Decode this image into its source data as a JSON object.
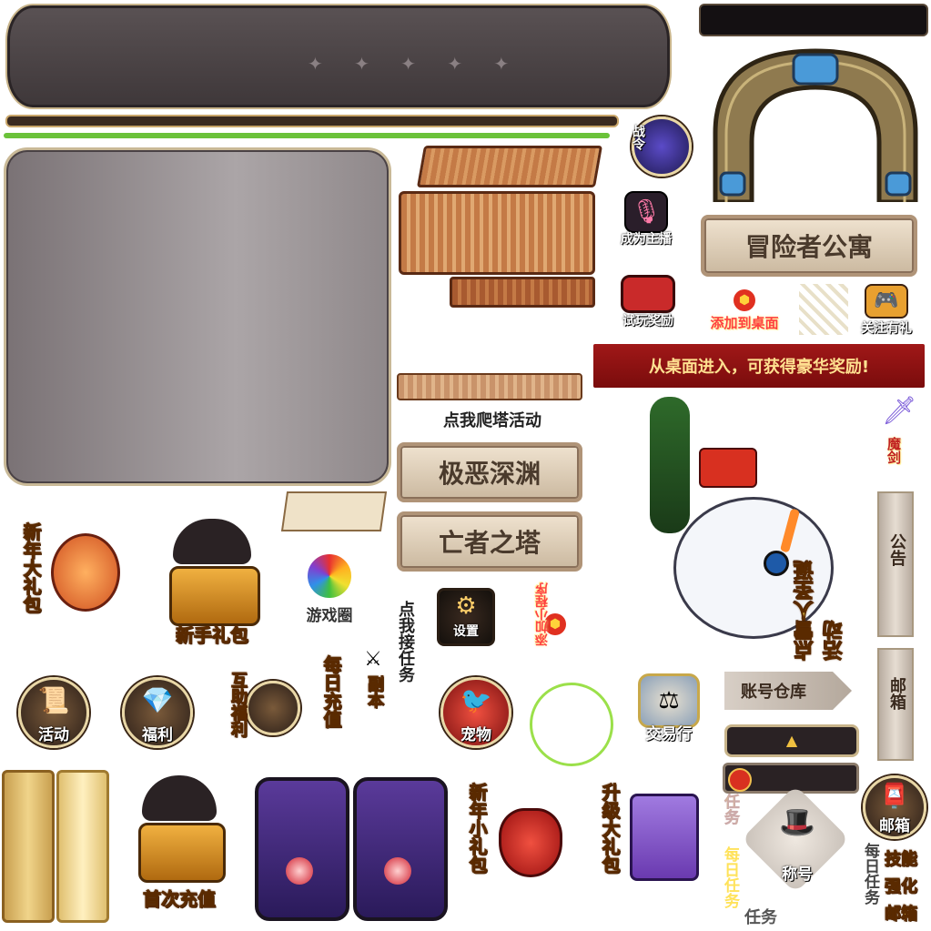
{
  "assets": {
    "battle_pass": "战令",
    "become_streamer": "成为主播",
    "trial_reward": "试玩奖励",
    "add_to_desktop": "添加到桌面",
    "follow_gift": "关注有礼",
    "adventurer_apartment": "冒险者公寓",
    "desktop_banner": "从桌面进入，可获得豪华奖励!",
    "tower_event": "点我爬塔活动",
    "abyss": "极恶深渊",
    "tower_of_dead": "亡者之塔",
    "new_year_pack": "新年大礼包",
    "newbie_pack": "新手礼包",
    "game_circle": "游戏圈",
    "accept_task": "点我接任务",
    "settings": "设置",
    "add_mini_program": "添加小程序",
    "snowman_event": "点雪人圣诞活动",
    "magic_sword": "魔剑",
    "announcement": "公告",
    "mailbox_tab": "邮箱",
    "account_warehouse": "账号仓库",
    "activity": "活动",
    "welfare": "福利",
    "mutual_aid": "互助福利",
    "daily_recharge": "每日充值",
    "dungeon": "副本",
    "pet": "宠物",
    "trade": "交易行",
    "first_recharge": "首次充值",
    "new_year_small_pack": "新年小礼包",
    "upgrade_pack": "升级大礼包",
    "task1": "任务",
    "daily_task1": "每日任务",
    "title": "称号",
    "task2": "任务",
    "mailbox": "邮箱",
    "daily_task2": "每日任务",
    "skill": "技能",
    "enhance": "强化",
    "mail": "邮箱"
  },
  "colors": {
    "gold_text": "#ffe25a",
    "dark_panel": "#4a4345",
    "banner_red": "#8c1010",
    "green_bar": "#6bc23a",
    "wood": "#b0663a"
  },
  "icons": [
    "microphone-icon",
    "handheld-console-icon",
    "gamepad-icon",
    "sword-icon",
    "gear-icon",
    "treasure-chest-icon",
    "pet-bird-icon",
    "trade-scale-icon",
    "hat-icon"
  ]
}
